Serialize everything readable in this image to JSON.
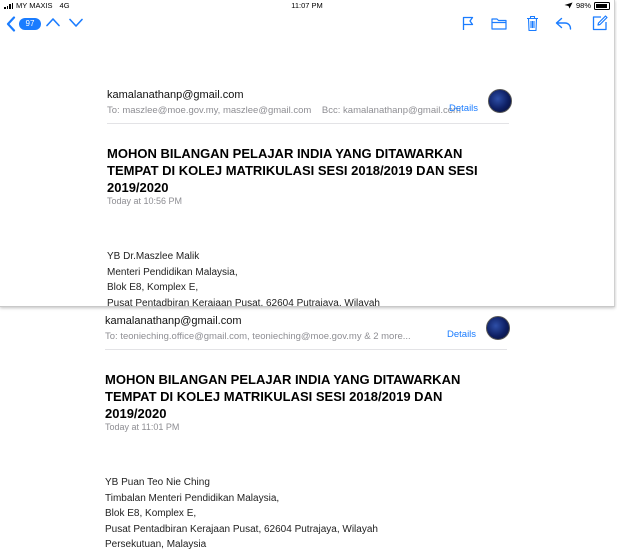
{
  "status_bar": {
    "carrier": "MY MAXIS",
    "network": "4G",
    "time": "11:07 PM",
    "battery": "98%"
  },
  "toolbar": {
    "unread_count": "97",
    "icons": [
      "back-icon",
      "up-arrow-icon",
      "down-arrow-icon",
      "flag-icon",
      "folder-icon",
      "trash-icon",
      "reply-icon",
      "compose-icon"
    ]
  },
  "email1": {
    "from": "kamalanathanp@gmail.com",
    "to_label": "To:",
    "to": "maszlee@moe.gov.my, maszlee@gmail.com",
    "bcc_label": "Bcc:",
    "bcc": "kamalanathanp@gmail.com",
    "details": "Details",
    "subject_lines": [
      "MOHON BILANGAN PELAJAR INDIA YANG DITAWARKAN",
      "TEMPAT DI KOLEJ MATRIKULASI SESI 2018/2019 DAN SESI",
      "2019/2020"
    ],
    "date": "Today at 10:56 PM",
    "body_lines": [
      "YB Dr.Maszlee Malik",
      "Menteri Pendidikan Malaysia,",
      "Blok E8, Komplex E,",
      "Pusat Pentadbiran Kerajaan Pusat, 62604 Putrajaya, Wilayah"
    ]
  },
  "email2": {
    "from": "kamalanathanp@gmail.com",
    "to_label": "To:",
    "to": "teonieching.office@gmail.com, teonieching@moe.gov.my & 2 more...",
    "details": "Details",
    "subject_lines": [
      "MOHON BILANGAN PELAJAR INDIA YANG DITAWARKAN",
      "TEMPAT DI KOLEJ MATRIKULASI SESI 2018/2019 DAN",
      "2019/2020"
    ],
    "date": "Today at 11:01 PM",
    "body_lines": [
      "YB Puan Teo Nie Ching",
      "Timbalan Menteri Pendidikan Malaysia,",
      "Blok E8, Komplex E,",
      "Pusat Pentadbiran Kerajaan Pusat, 62604 Putrajaya, Wilayah",
      "Persekutuan, Malaysia"
    ]
  }
}
